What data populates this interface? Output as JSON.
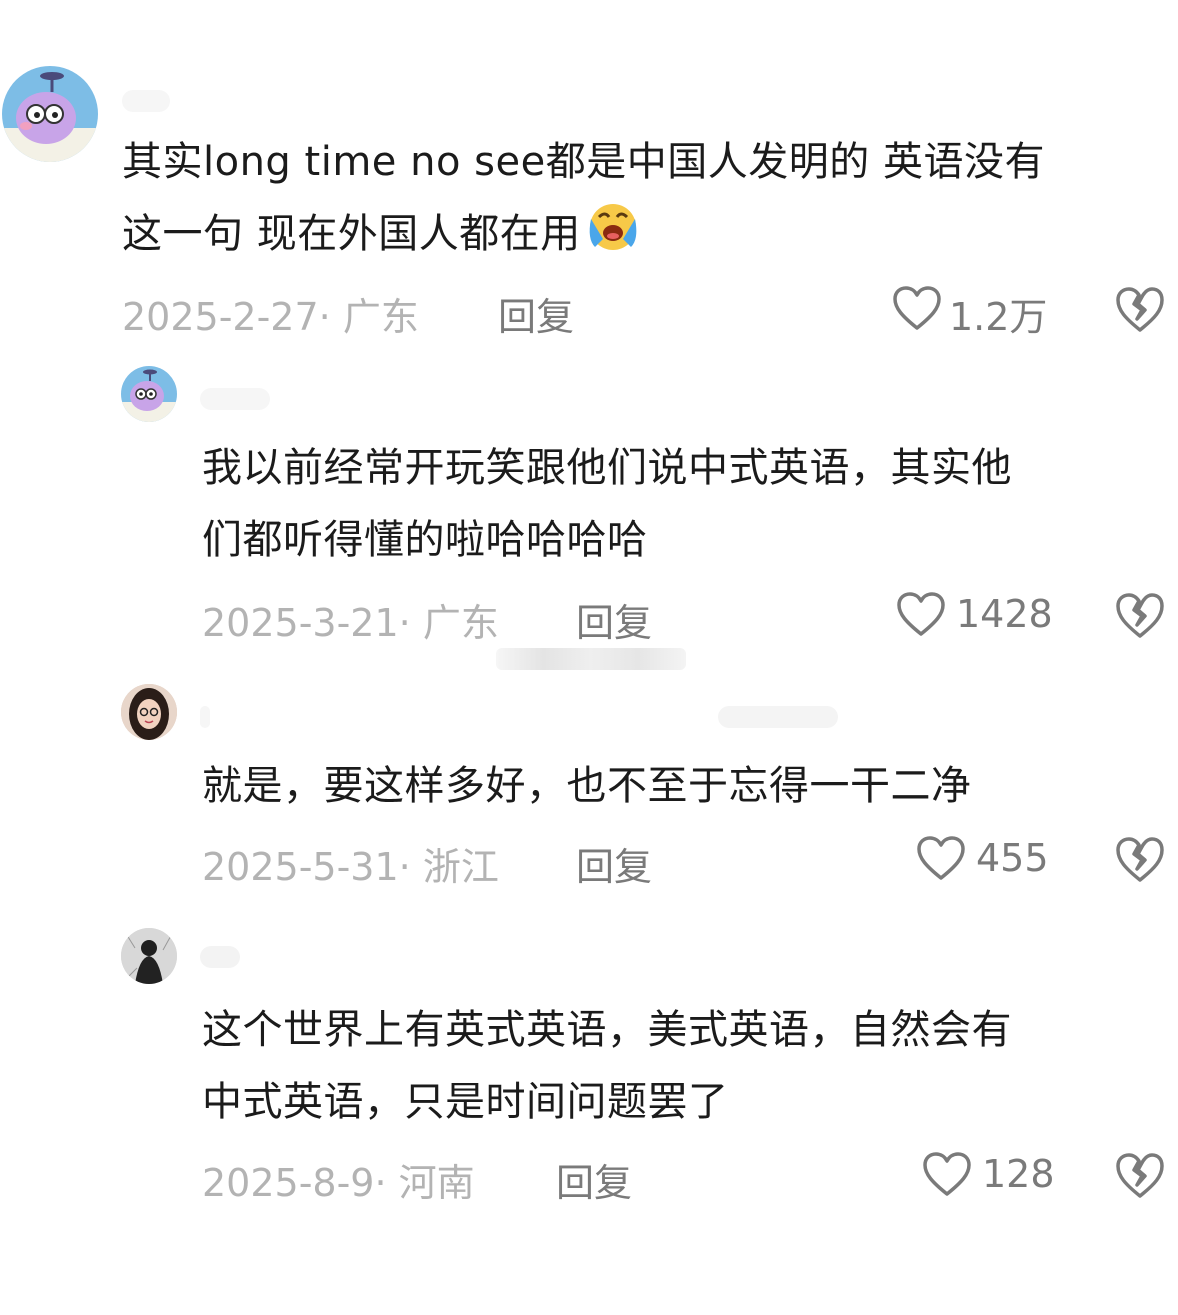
{
  "comments": [
    {
      "text": "其实long time no see都是中国人发明的 英语没有这一句 现在外国人都在用",
      "text_lines": [
        "其实long time no see都是中国人发明的 英语没有",
        "这一句 现在外国人都在用"
      ],
      "emoji": "loudly-crying-face",
      "date_location": "2025-2-27· 广东",
      "reply_label": "回复",
      "likes": "1.2万"
    },
    {
      "text_lines": [
        "我以前经常开玩笑跟他们说中式英语，其实他",
        "们都听得懂的啦哈哈哈哈"
      ],
      "date_location": "2025-3-21· 广东",
      "reply_label": "回复",
      "likes": "1428"
    },
    {
      "text_lines": [
        "就是，要这样多好，也不至于忘得一干二净"
      ],
      "date_location": "2025-5-31· 浙江",
      "reply_label": "回复",
      "likes": "455"
    },
    {
      "text_lines": [
        "这个世界上有英式英语，美式英语，自然会有",
        "中式英语，只是时间问题罢了"
      ],
      "date_location": "2025-8-9· 河南",
      "reply_label": "回复",
      "likes": "128"
    }
  ],
  "icons": {
    "like": "heart-outline-icon",
    "dislike": "broken-heart-icon"
  }
}
